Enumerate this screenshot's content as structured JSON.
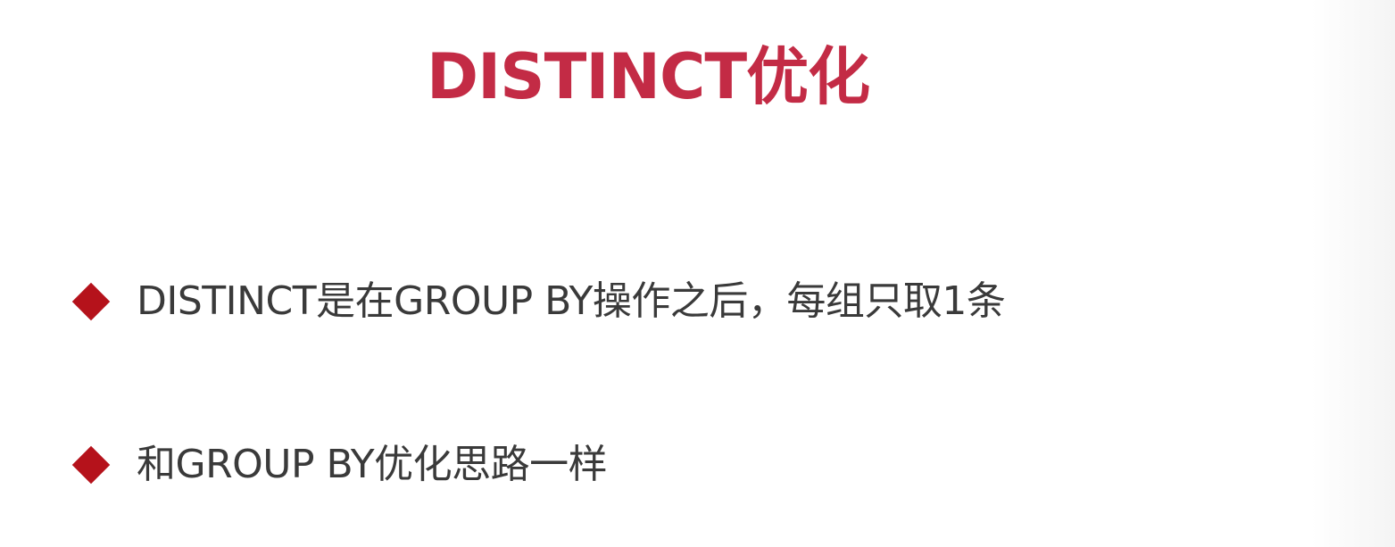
{
  "slide": {
    "title": "DISTINCT优化",
    "bullets": [
      {
        "text": "DISTINCT是在GROUP BY操作之后，每组只取1条"
      },
      {
        "text": "和GROUP BY优化思路一样"
      }
    ]
  },
  "colors": {
    "title": "#c32b45",
    "bullet_marker": "#b5121b",
    "body_text": "#3a3a3a",
    "background": "#ffffff"
  }
}
